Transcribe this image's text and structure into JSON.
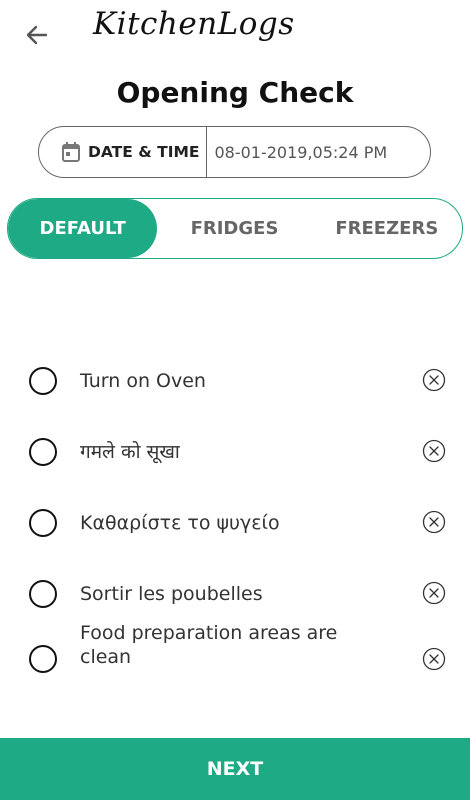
{
  "header": {
    "back_icon": "arrow-left-icon",
    "app_name": "KitchenLogs"
  },
  "page": {
    "title": "Opening Check"
  },
  "datetime": {
    "icon": "calendar-icon",
    "label": "DATE & TIME",
    "value": "08-01-2019,05:24 PM"
  },
  "tabs": [
    {
      "label": "DEFAULT",
      "active": true
    },
    {
      "label": "FRIDGES",
      "active": false
    },
    {
      "label": "FREEZERS",
      "active": false
    }
  ],
  "checklist": [
    {
      "label": "Turn on Oven",
      "checked": false
    },
    {
      "label": "गमले को सूखा",
      "checked": false
    },
    {
      "label": "Καθαρίστε το ψυγείο",
      "checked": false
    },
    {
      "label": "Sortir les poubelles",
      "checked": false
    },
    {
      "label": "Food preparation areas are clean",
      "checked": false
    }
  ],
  "footer": {
    "next_label": "NEXT"
  },
  "colors": {
    "accent": "#1faa86",
    "text_dark": "#111111",
    "text_muted": "#666666"
  }
}
